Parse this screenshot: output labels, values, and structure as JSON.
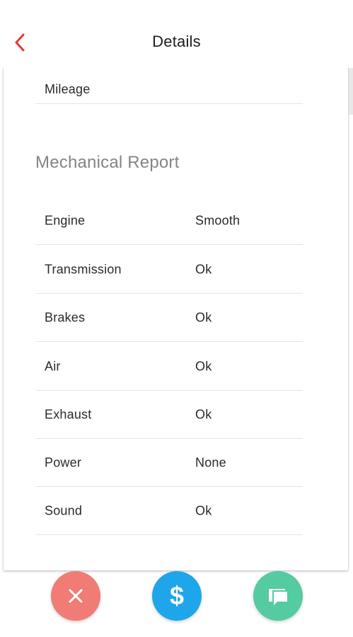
{
  "header": {
    "title": "Details",
    "back_icon": "chevron-left-icon",
    "accent_color": "#e53935"
  },
  "details": {
    "mileage_label": "Mileage"
  },
  "mechanical_report": {
    "title": "Mechanical Report",
    "rows": [
      {
        "label": "Engine",
        "value": "Smooth"
      },
      {
        "label": "Transmission",
        "value": "Ok"
      },
      {
        "label": "Brakes",
        "value": "Ok"
      },
      {
        "label": "Air",
        "value": "Ok"
      },
      {
        "label": "Exhaust",
        "value": "Ok"
      },
      {
        "label": "Power",
        "value": "None"
      },
      {
        "label": "Sound",
        "value": "Ok"
      }
    ]
  },
  "actions": {
    "close": {
      "icon": "close-icon",
      "color": "#f07c75"
    },
    "price": {
      "icon": "dollar-icon",
      "symbol": "$",
      "color": "#1fa6ea"
    },
    "chat": {
      "icon": "chat-icon",
      "color": "#54cba0"
    }
  }
}
